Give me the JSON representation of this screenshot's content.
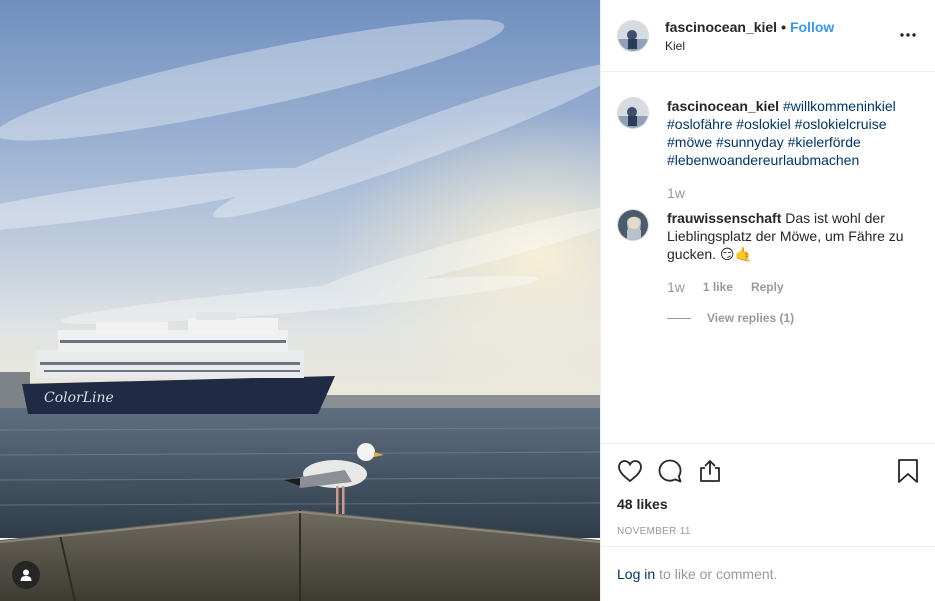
{
  "post": {
    "username": "fascinocean_kiel",
    "follow_label": "Follow",
    "separator": "•",
    "location": "Kiel"
  },
  "caption": {
    "username": "fascinocean_kiel",
    "hashtags": [
      "#willkommeninkiel",
      "#oslofähre",
      "#oslokiel",
      "#oslokielcruise",
      "#möwe",
      "#sunnyday",
      "#kielerförde",
      "#lebenwoandereurlaubmachen"
    ],
    "time": "1w"
  },
  "comment": {
    "username": "frauwissenschaft",
    "text": "Das ist wohl der Lieblingsplatz der Möwe, um Fähre zu gucken. 😏🤙",
    "time": "1w",
    "likes": "1 like",
    "reply_label": "Reply",
    "view_replies": "View replies (1)"
  },
  "engagement": {
    "likes": "48 likes",
    "date": "NOVEMBER 11"
  },
  "login": {
    "link": "Log in",
    "rest": "to like or comment."
  },
  "image": {
    "ship_hull_text": "ColorLine",
    "icons": [
      "user-tag-icon",
      "heart-icon",
      "comment-icon",
      "share-icon",
      "bookmark-icon",
      "more-icon"
    ],
    "colors": {
      "follow": "#3897f0",
      "hashtag": "#003569",
      "muted": "#999999"
    }
  }
}
